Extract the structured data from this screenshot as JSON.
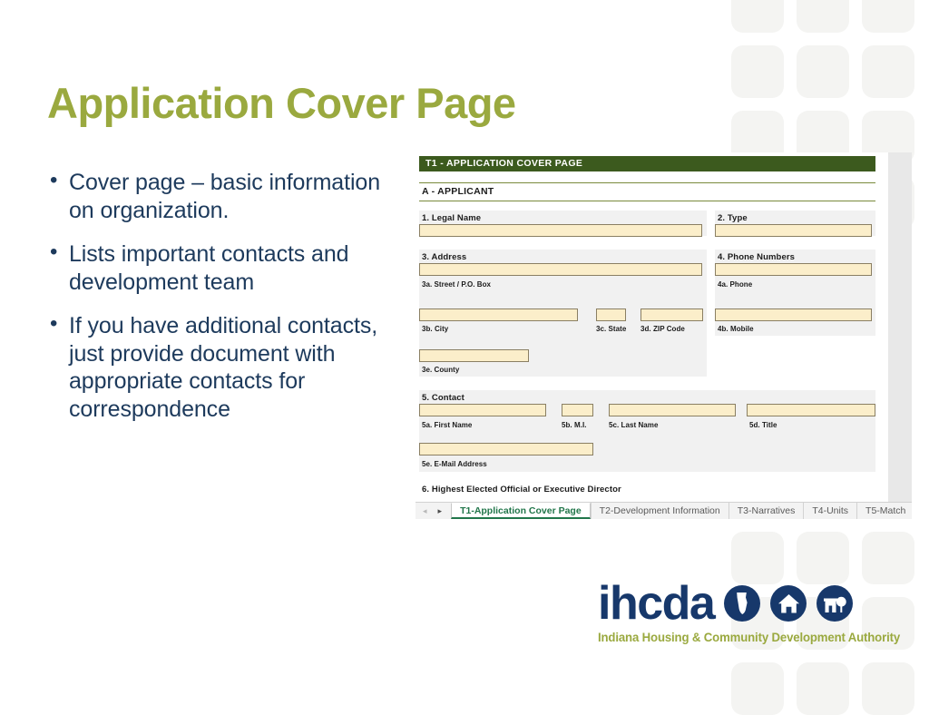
{
  "slide": {
    "title": "Application Cover Page",
    "title_color": "#9aa93f",
    "body_color": "#1d3a5c",
    "bullets": [
      "Cover page – basic information on organization.",
      "Lists important contacts and development team",
      "If you have additional contacts, just provide document with appropriate contacts for correspondence"
    ]
  },
  "excel": {
    "form_title": "T1 - APPLICATION COVER PAGE",
    "form_title_bg": "#3c5a1e",
    "section_a": "A - APPLICANT",
    "input_fill": "#fbeeca",
    "fields": {
      "legal_name": "1. Legal Name",
      "type": "2. Type",
      "address": "3. Address",
      "street": "3a. Street / P.O. Box",
      "city": "3b. City",
      "state": "3c. State",
      "zip": "3d. ZIP Code",
      "county": "3e. County",
      "phone_numbers": "4. Phone Numbers",
      "phone": "4a. Phone",
      "mobile": "4b. Mobile",
      "contact": "5. Contact",
      "first_name": "5a. First Name",
      "mi": "5b. M.I.",
      "last_name": "5c. Last Name",
      "title_fld": "5d. Title",
      "email": "5e. E-Mail Address",
      "highest_official": "6. Highest Elected Official or Executive Director"
    },
    "tabbar": {
      "prev_arrow": "◂",
      "next_arrow": "▸",
      "tabs": [
        {
          "label": "T1-Application Cover Page",
          "active": true
        },
        {
          "label": "T2-Development Information",
          "active": false
        },
        {
          "label": "T3-Narratives",
          "active": false
        },
        {
          "label": "T4-Units",
          "active": false
        },
        {
          "label": "T5-Match",
          "active": false
        }
      ],
      "active_tab_color": "#21764a"
    }
  },
  "logo": {
    "wordmark": "ihcda",
    "tagline": "Indiana Housing & Community Development Authority",
    "wordmark_color": "#17386b",
    "tagline_color": "#9aa93f",
    "icons": [
      "indiana-state-outline-icon",
      "house-icon",
      "house-with-tree-icon"
    ]
  }
}
